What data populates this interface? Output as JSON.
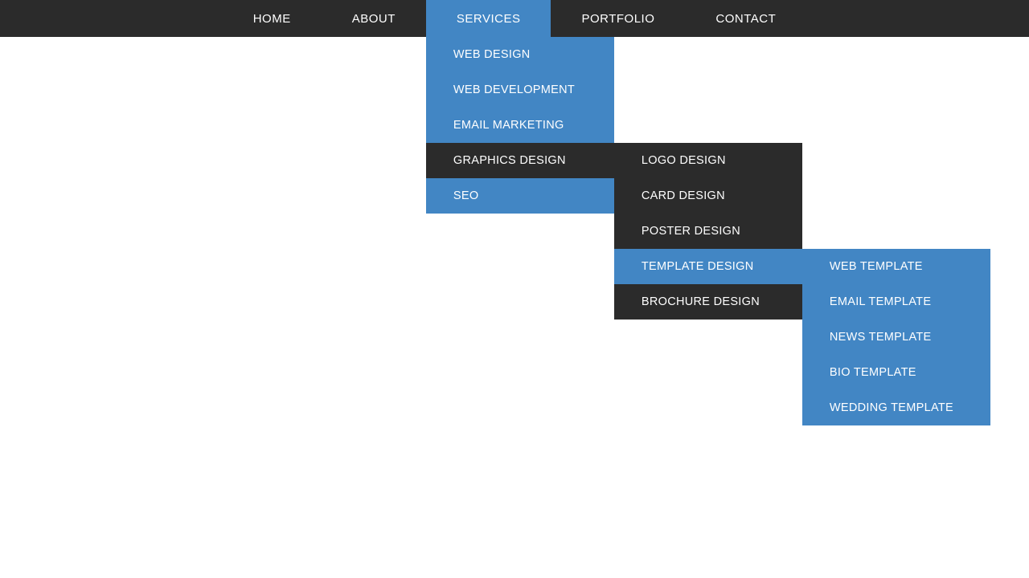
{
  "colors": {
    "dark": "#2b2b2b",
    "accent": "#4286c4",
    "text": "#ffffff"
  },
  "nav": {
    "home": "HOME",
    "about": "ABOUT",
    "services": "SERVICES",
    "portfolio": "PORTFOLIO",
    "contact": "CONTACT"
  },
  "services_submenu": {
    "web_design": "WEB DESIGN",
    "web_development": "WEB DEVELOPMENT",
    "email_marketing": "EMAIL MARKETING",
    "graphics_design": "GRAPHICS DESIGN",
    "seo": "SEO"
  },
  "graphics_submenu": {
    "logo_design": "LOGO DESIGN",
    "card_design": "CARD DESIGN",
    "poster_design": "POSTER DESIGN",
    "template_design": "TEMPLATE DESIGN",
    "brochure_design": "BROCHURE DESIGN"
  },
  "template_submenu": {
    "web_template": "WEB TEMPLATE",
    "email_template": "EMAIL TEMPLATE",
    "news_template": "NEWS TEMPLATE",
    "bio_template": "BIO TEMPLATE",
    "wedding_template": "WEDDING TEMPLATE"
  }
}
